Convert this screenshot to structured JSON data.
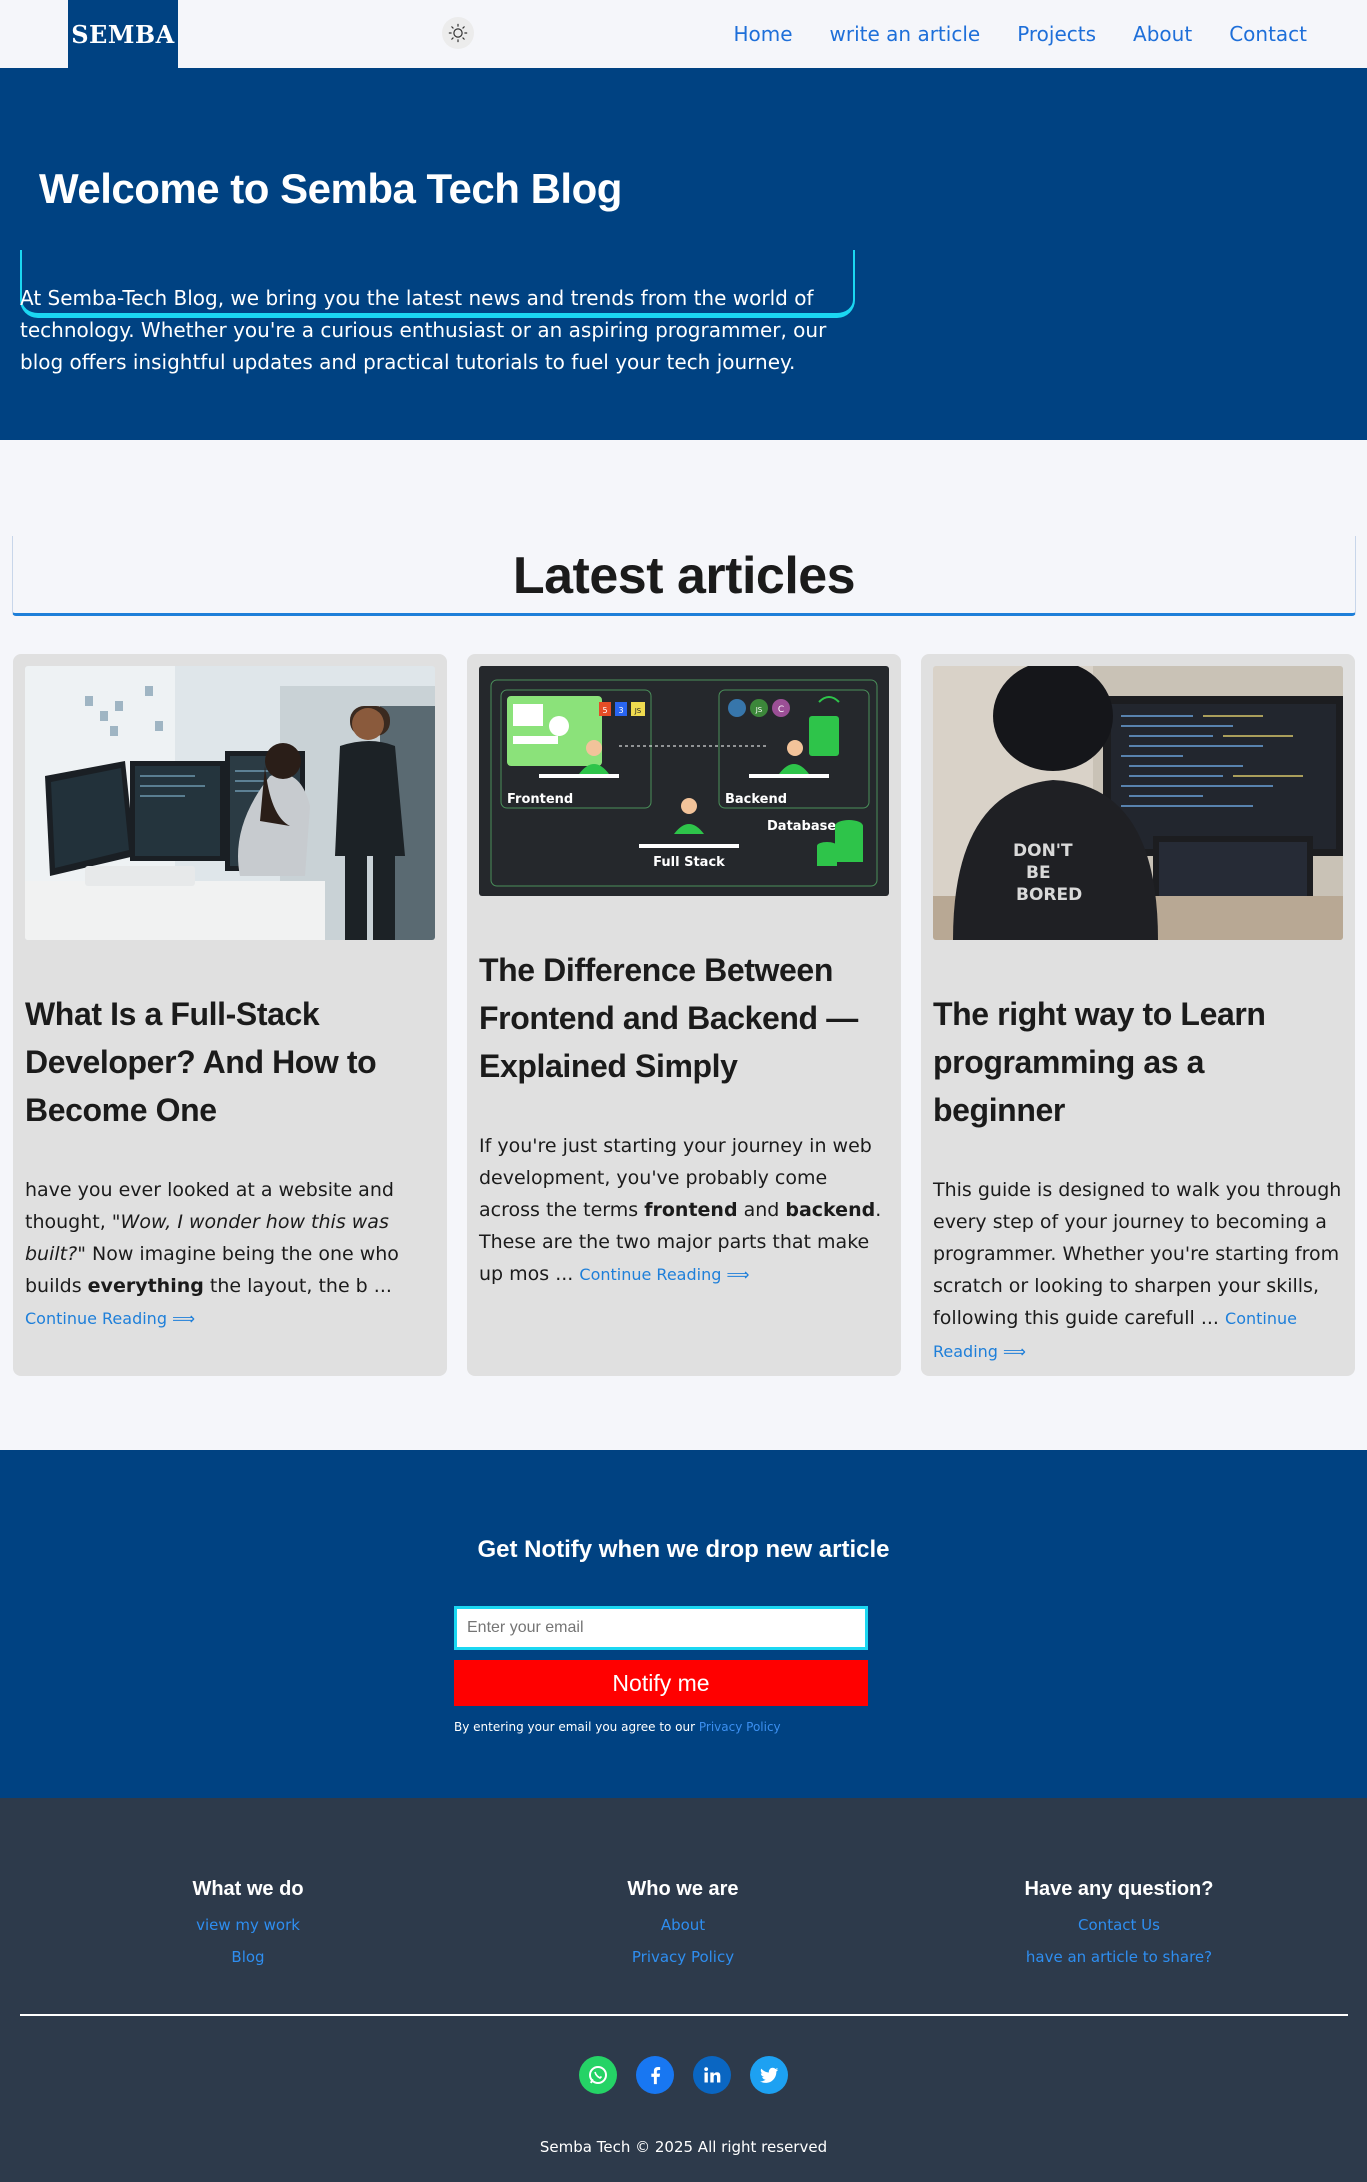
{
  "nav": {
    "logo": "SEMBA",
    "links": [
      "Home",
      "write an article",
      "Projects",
      "About",
      "Contact"
    ]
  },
  "hero": {
    "title": "Welcome to Semba Tech Blog",
    "text": "At Semba-Tech Blog, we bring you the latest news and trends from the world of technology. Whether you're a curious enthusiast or an aspiring programmer, our blog offers insightful updates and practical tutorials to fuel your tech journey."
  },
  "articles": {
    "heading": "Latest articles",
    "continue_label": "Continue Reading ⟹",
    "items": [
      {
        "title": "What Is a Full-Stack Developer? And How to Become One",
        "excerpt_1": "have you ever looked at a website and thought, ",
        "excerpt_em": "\"Wow, I wonder how this was built?\"",
        "excerpt_2": " Now imagine being the one who builds ",
        "excerpt_strong": "everything",
        "excerpt_3": " the layout, the b ..."
      },
      {
        "title": "The Difference Between Frontend and Backend — Explained Simply",
        "excerpt_1": "If you're just starting your journey in web development, you've probably come across the terms ",
        "excerpt_strong": "frontend",
        "excerpt_2": " and ",
        "excerpt_strong2": "backend",
        "excerpt_3": ". These are the two major parts that make up mos ...",
        "diagram_labels": {
          "frontend": "Frontend",
          "backend": "Backend",
          "database": "Database",
          "fullstack": "Full Stack",
          "html": "5",
          "css": "3",
          "js": "JS",
          "node": "JS",
          "csharp": "C"
        }
      },
      {
        "title": "The right way to Learn programming as a beginner",
        "excerpt": "This guide is designed to walk you through every step of your journey to becoming a programmer. Whether you're starting from scratch or looking to sharpen your skills, following this guide carefull ...",
        "shirt_text": [
          "DON'T",
          "BE",
          "BORED"
        ]
      }
    ]
  },
  "notify": {
    "title": "Get Notify when we drop new article",
    "placeholder": "Enter your email",
    "button": "Notify me",
    "agree_text": "By entering your email you agree to our ",
    "privacy_link": "Privacy Policy"
  },
  "footer": {
    "columns": [
      {
        "title": "What we do",
        "links": [
          "view my work",
          "Blog"
        ]
      },
      {
        "title": "Who we are",
        "links": [
          "About",
          "Privacy Policy"
        ]
      },
      {
        "title": "Have any question?",
        "links": [
          "Contact Us",
          "have an article to share?"
        ]
      }
    ],
    "socials": [
      "whatsapp-icon",
      "facebook-icon",
      "linkedin-icon",
      "twitter-icon"
    ],
    "copyright": "Semba Tech © 2025 All right reserved"
  },
  "colors": {
    "brand_blue": "#004282",
    "accent_cyan": "#1bd7f2",
    "link_blue": "#1e7fd9",
    "notify_red": "#ff0000",
    "footer_bg": "#2d3a4b"
  }
}
